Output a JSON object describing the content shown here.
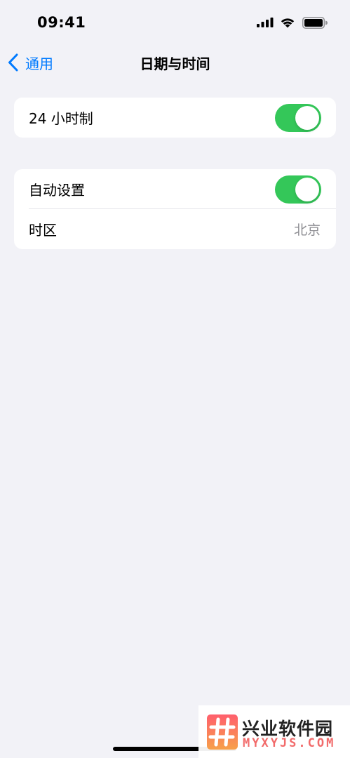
{
  "status_bar": {
    "time": "09:41"
  },
  "nav": {
    "back_label": "通用",
    "title": "日期与时间"
  },
  "sections": {
    "clock": {
      "label": "24 小时制",
      "toggle_on": true
    },
    "auto": {
      "label": "自动设置",
      "toggle_on": true
    },
    "timezone": {
      "label": "时区",
      "value": "北京"
    }
  },
  "colors": {
    "accent": "#007aff",
    "toggle_on": "#34c759",
    "background": "#f2f2f7",
    "secondary_text": "#8e8e93"
  },
  "watermark": {
    "title": "兴业软件园",
    "subtitle": "MYXYJS.COM"
  }
}
